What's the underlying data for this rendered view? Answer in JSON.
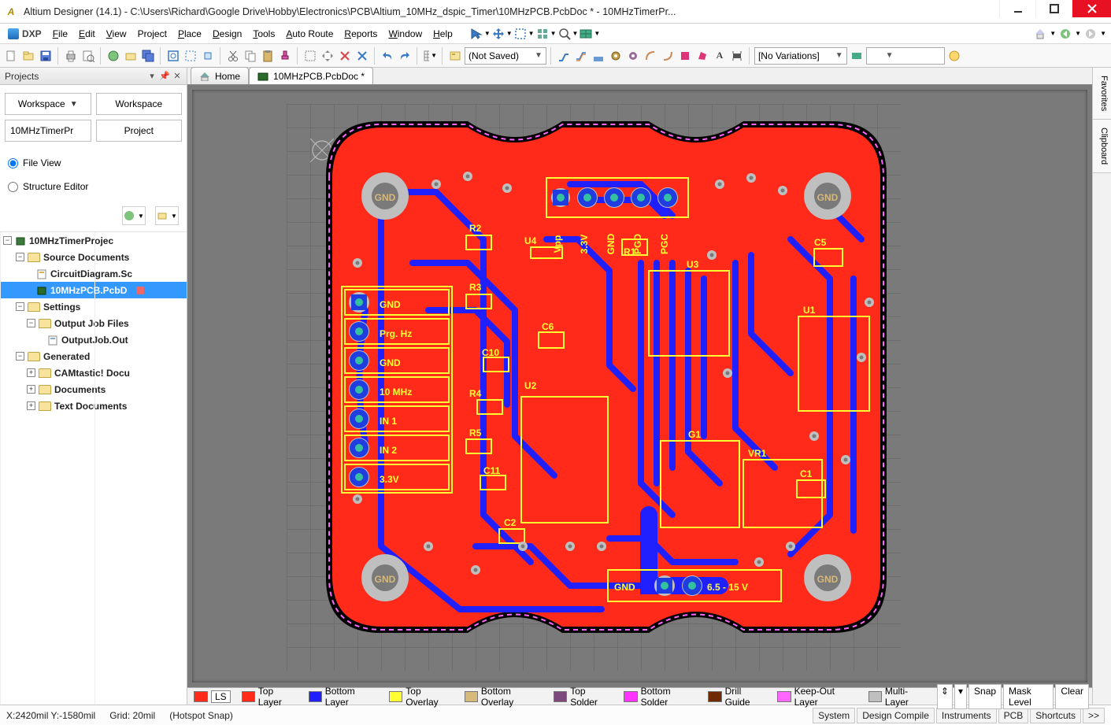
{
  "titlebar": {
    "text": "Altium Designer (14.1) - C:\\Users\\Richard\\Google Drive\\Hobby\\Electronics\\PCB\\Altium_10MHz_dspic_Timer\\10MHzPCB.PcbDoc * - 10MHzTimerPr..."
  },
  "menubar": {
    "dxp": "DXP",
    "items": [
      "File",
      "Edit",
      "View",
      "Project",
      "Place",
      "Design",
      "Tools",
      "Auto Route",
      "Reports",
      "Window",
      "Help"
    ]
  },
  "toolbar": {
    "combo1": "(Not Saved)",
    "combo2": "[No Variations]"
  },
  "projects_panel": {
    "title": "Projects",
    "workspace_btn": "Workspace",
    "workspace_btn2": "Workspace",
    "project_name": "10MHzTimerPr",
    "project_btn": "Project",
    "radio_file_view": "File View",
    "radio_struct": "Structure Editor",
    "tree": {
      "root": "10MHzTimerProjec",
      "source_docs": "Source Documents",
      "circuit": "CircuitDiagram.Sc",
      "pcb": "10MHzPCB.PcbD",
      "settings": "Settings",
      "output_job_files": "Output Job Files",
      "output_job": "OutputJob.Out",
      "generated": "Generated",
      "camtastic": "CAMtastic! Docu",
      "documents": "Documents",
      "text_docs": "Text Documents"
    }
  },
  "doc_tabs": {
    "home": "Home",
    "pcb": "10MHzPCB.PcbDoc *"
  },
  "pcb": {
    "mounting_label": "GND",
    "header_pins": [
      "Vpp",
      "3.3V",
      "GND",
      "PGD",
      "PGC"
    ],
    "left_conn": [
      "GND",
      "Prg. Hz",
      "GND",
      "10 MHz",
      "IN 1",
      "IN 2",
      "3.3V"
    ],
    "bottom_power_gnd": "GND",
    "bottom_power_v": "6.5 - 15 V",
    "des": {
      "R1": "R1",
      "R2": "R2",
      "R3": "R3",
      "R4": "R4",
      "R5": "R5",
      "C1": "C1",
      "C2": "C2",
      "C5": "C5",
      "C6": "C6",
      "C10": "C10",
      "C11": "C11",
      "U1": "U1",
      "U2": "U2",
      "U3": "U3",
      "U4": "U4",
      "G1": "G1",
      "VR1": "VR1"
    }
  },
  "layer_bar": {
    "ls": "LS",
    "layers": [
      {
        "name": "Top Layer",
        "color": "#ff2a1a"
      },
      {
        "name": "Bottom Layer",
        "color": "#2020ff"
      },
      {
        "name": "Top Overlay",
        "color": "#ffff33"
      },
      {
        "name": "Bottom Overlay",
        "color": "#d7b97a"
      },
      {
        "name": "Top Solder",
        "color": "#7d4a7d"
      },
      {
        "name": "Bottom Solder",
        "color": "#ff33ff"
      },
      {
        "name": "Drill Guide",
        "color": "#6e2a00"
      },
      {
        "name": "Keep-Out Layer",
        "color": "#ff66ff"
      },
      {
        "name": "Multi-Layer",
        "color": "#bfbfbf"
      }
    ],
    "snap": "Snap",
    "mask": "Mask Level",
    "clear": "Clear"
  },
  "status": {
    "coords": "X:2420mil Y:-1580mil",
    "grid": "Grid: 20mil",
    "snap": "(Hotspot Snap)",
    "buttons": [
      "System",
      "Design Compile",
      "Instruments",
      "PCB",
      "Shortcuts",
      ">>"
    ]
  },
  "right_tabs": [
    "Favorites",
    "Clipboard"
  ]
}
